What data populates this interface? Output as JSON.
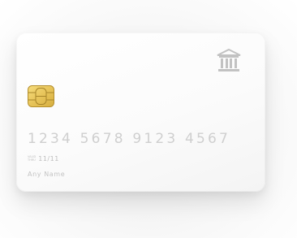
{
  "card": {
    "number": "1234 5678 9123 4567",
    "valid_thru_top": "VALID",
    "valid_thru_bottom": "THRU",
    "expiry": "11/11",
    "holder": "Any Name"
  },
  "icons": {
    "bank": "bank-icon",
    "chip": "chip-icon"
  },
  "colors": {
    "chip_gold": "#E9C95A",
    "text_gray": "#CFCFCF",
    "icon_gray": "#BDBDBD"
  }
}
